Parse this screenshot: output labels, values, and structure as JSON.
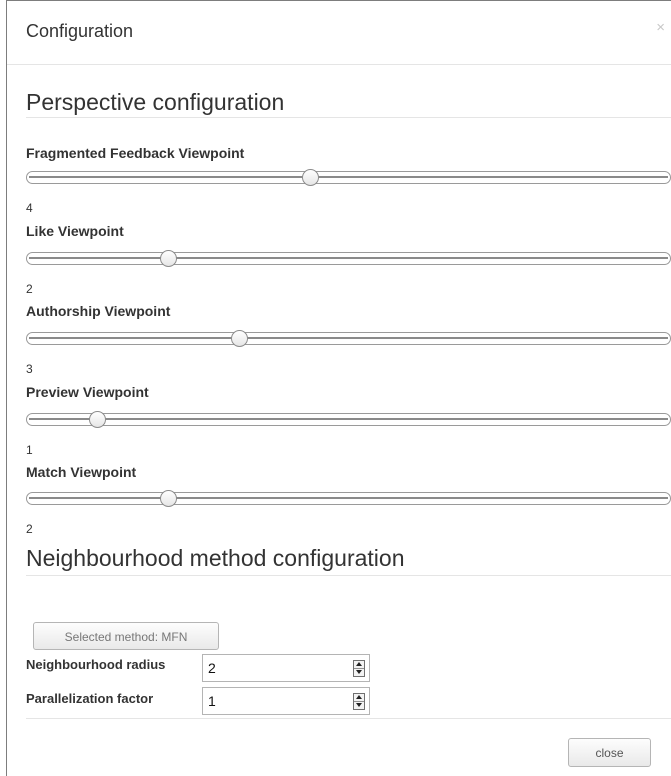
{
  "dialog": {
    "title": "Configuration",
    "close_symbol": "×"
  },
  "perspective": {
    "title": "Perspective configuration",
    "viewpoints": [
      {
        "label": "Fragmented Feedback Viewpoint",
        "value": "4",
        "level_fraction": 0.44
      },
      {
        "label": "Like Viewpoint",
        "value": "2",
        "level_fraction": 0.22
      },
      {
        "label": "Authorship Viewpoint",
        "value": "3",
        "level_fraction": 0.33
      },
      {
        "label": "Preview Viewpoint",
        "value": "1",
        "level_fraction": 0.11
      },
      {
        "label": "Match Viewpoint",
        "value": "2",
        "level_fraction": 0.22
      }
    ]
  },
  "neighbourhood": {
    "title": "Neighbourhood method configuration",
    "method_button_label": "Selected method: MFN",
    "radius_label": "Neighbourhood radius",
    "radius_value": "2",
    "parallelization_label": "Parallelization factor",
    "parallelization_value": "1"
  },
  "footer": {
    "close_label": "close"
  }
}
